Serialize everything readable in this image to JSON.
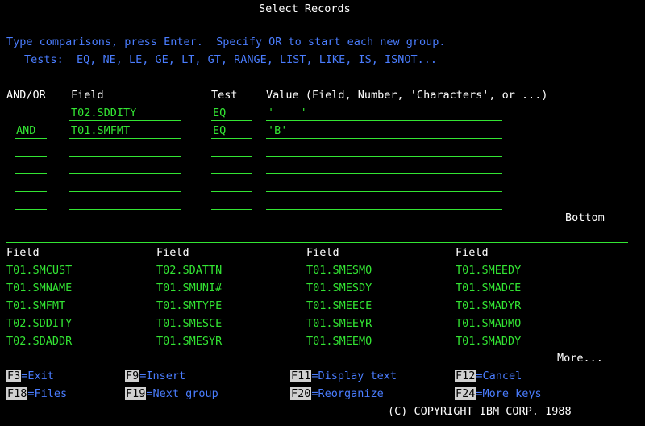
{
  "title": "Select Records",
  "instructions": "Type comparisons, press Enter.  Specify OR to start each new group.",
  "tests_line": "Tests:  EQ, NE, LE, GE, LT, GT, RANGE, LIST, LIKE, IS, ISNOT...",
  "headers": {
    "andor": "AND/OR",
    "field": "Field",
    "test": "Test",
    "value": "Value (Field, Number, 'Characters', or ...)"
  },
  "rows": [
    {
      "andor": "",
      "field": "T02.SDDITY",
      "test": "EQ",
      "value": "'    '"
    },
    {
      "andor": "AND",
      "field": "T01.SMFMT",
      "test": "EQ",
      "value": "'B'"
    },
    {
      "andor": "",
      "field": "",
      "test": "",
      "value": ""
    },
    {
      "andor": "",
      "field": "",
      "test": "",
      "value": ""
    },
    {
      "andor": "",
      "field": "",
      "test": "",
      "value": ""
    },
    {
      "andor": "",
      "field": "",
      "test": "",
      "value": ""
    }
  ],
  "bottom_label": "Bottom",
  "field_list_header": "Field",
  "field_list": [
    [
      "T01.SMCUST",
      "T02.SDATTN",
      "T01.SMESMO",
      "T01.SMEEDY"
    ],
    [
      "T01.SMNAME",
      "T01.SMUNI#",
      "T01.SMESDY",
      "T01.SMADCE"
    ],
    [
      "T01.SMFMT",
      "T01.SMTYPE",
      "T01.SMEECE",
      "T01.SMADYR"
    ],
    [
      "T02.SDDITY",
      "T01.SMESCE",
      "T01.SMEEYR",
      "T01.SMADMO"
    ],
    [
      "T02.SDADDR",
      "T01.SMESYR",
      "T01.SMEEMO",
      "T01.SMADDY"
    ]
  ],
  "more_label": "More...",
  "fkeys": [
    {
      "key": "F3",
      "label": "=Exit"
    },
    {
      "key": "F9",
      "label": "=Insert"
    },
    {
      "key": "F11",
      "label": "=Display text"
    },
    {
      "key": "F12",
      "label": "=Cancel"
    },
    {
      "key": "F18",
      "label": "=Files"
    },
    {
      "key": "F19",
      "label": "=Next group"
    },
    {
      "key": "F20",
      "label": "=Reorganize"
    },
    {
      "key": "F24",
      "label": "=More keys"
    }
  ],
  "copyright": "(C) COPYRIGHT IBM CORP. 1988"
}
